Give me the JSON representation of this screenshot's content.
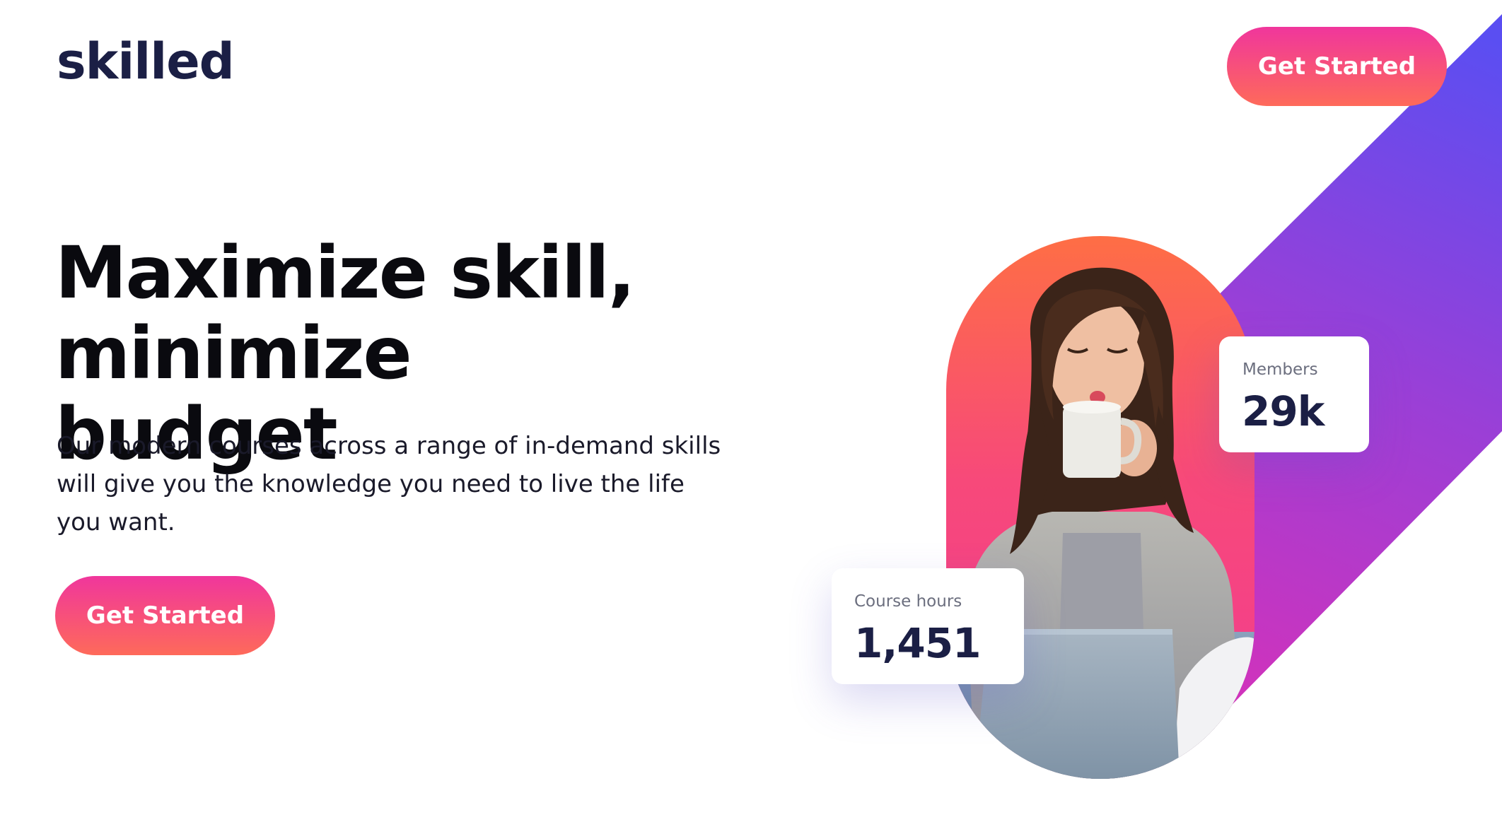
{
  "header": {
    "logo_text": "skilled",
    "cta_label": "Get Started"
  },
  "hero": {
    "headline_line1": "Maximize skill,",
    "headline_line2": "minimize budget",
    "description": "Our modern courses across a range of in-demand skills will give you the knowledge you need to live the life you want.",
    "cta_label": "Get Started"
  },
  "stats": {
    "members": {
      "label": "Members",
      "value": "29k"
    },
    "course_hours": {
      "label": "Course hours",
      "value": "1,451"
    }
  },
  "colors": {
    "brand_navy": "#1b1f45",
    "cta_gradient_top": "#f0369c",
    "cta_gradient_bottom": "#fe6a5a",
    "stripe_pink": "#e02fb4",
    "stripe_violet": "#5a4ef2",
    "arch_top": "#fe6e45",
    "arch_bottom": "#f23a92"
  },
  "icons": {
    "hero_image": "woman-drinking-coffee-photo"
  }
}
